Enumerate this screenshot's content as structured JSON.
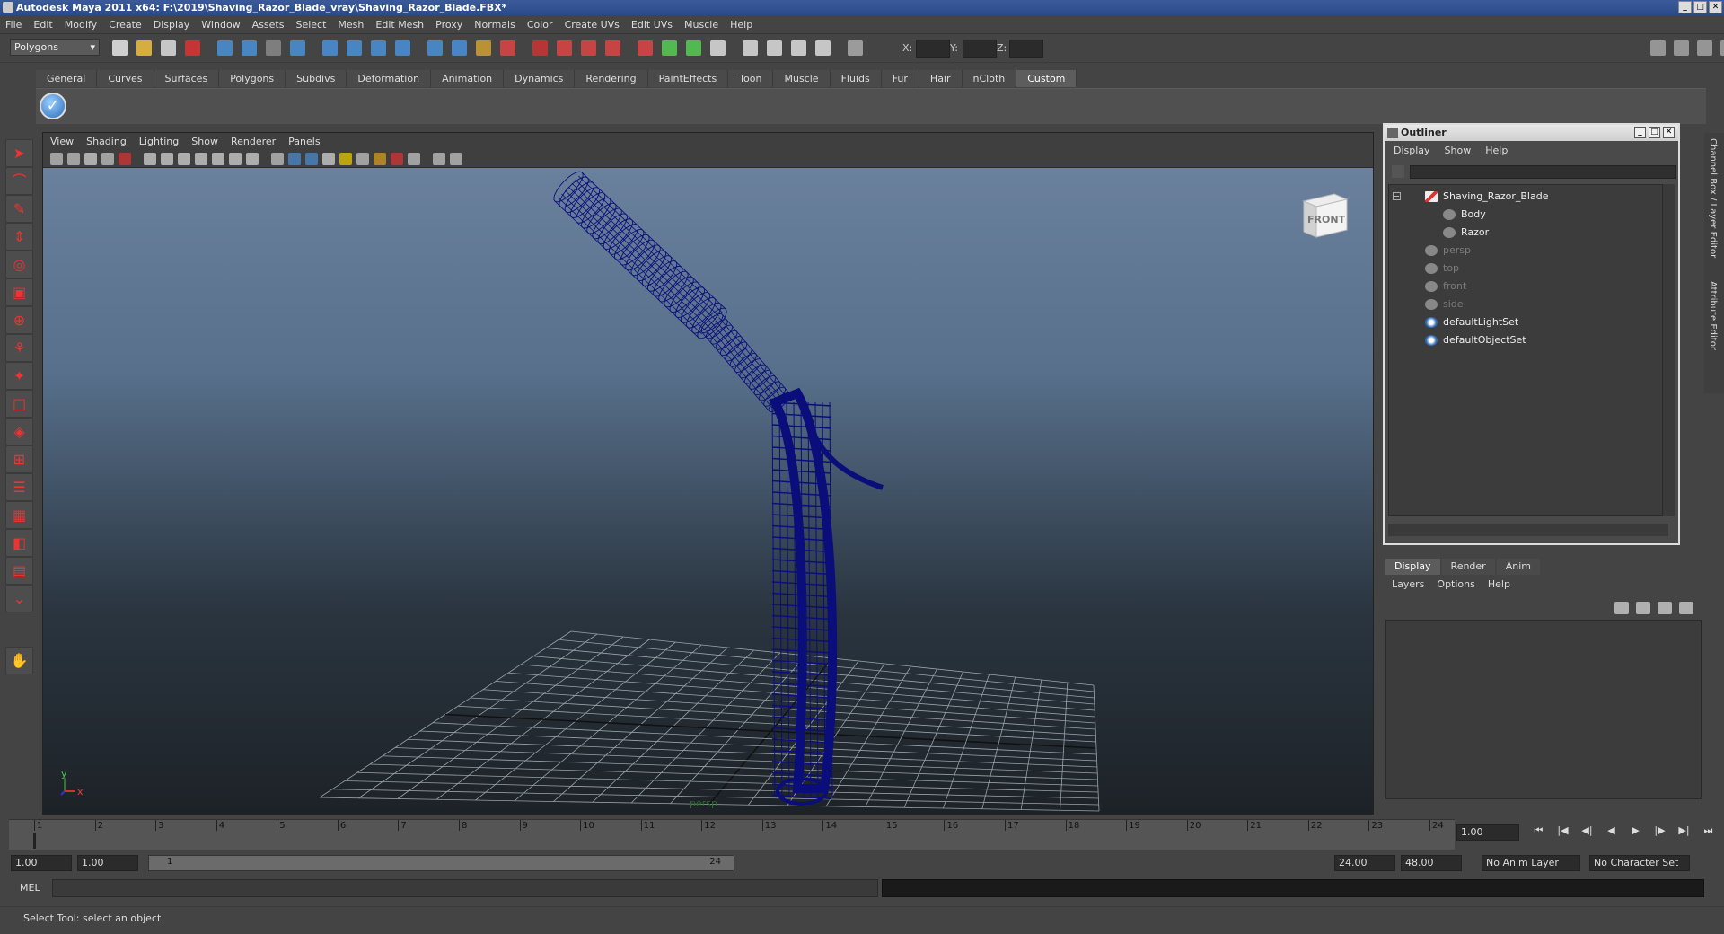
{
  "window": {
    "title": "Autodesk Maya 2011 x64: F:\\2019\\Shaving_Razor_Blade_vray\\Shaving_Razor_Blade.FBX*"
  },
  "menubar": [
    "File",
    "Edit",
    "Modify",
    "Create",
    "Display",
    "Window",
    "Assets",
    "Select",
    "Mesh",
    "Edit Mesh",
    "Proxy",
    "Normals",
    "Color",
    "Create UVs",
    "Edit UVs",
    "Muscle",
    "Help"
  ],
  "toolbar": {
    "mode": "Polygons",
    "x_label": "X:",
    "y_label": "Y:",
    "z_label": "Z:"
  },
  "shelf": {
    "tabs": [
      "General",
      "Curves",
      "Surfaces",
      "Polygons",
      "Subdivs",
      "Deformation",
      "Animation",
      "Dynamics",
      "Rendering",
      "PaintEffects",
      "Toon",
      "Muscle",
      "Fluids",
      "Fur",
      "Hair",
      "nCloth",
      "Custom"
    ],
    "active": "Custom"
  },
  "viewport": {
    "menu": [
      "View",
      "Shading",
      "Lighting",
      "Show",
      "Renderer",
      "Panels"
    ],
    "viewcube_label": "FRONT",
    "axis_y": "y",
    "axis_x": "x",
    "camera_label": "persp",
    "wire_color": "#0b0e7a"
  },
  "outliner": {
    "title": "Outliner",
    "menu": [
      "Display",
      "Show",
      "Help"
    ],
    "items": [
      {
        "label": "Shaving_Razor_Blade",
        "dim": false,
        "type": "root"
      },
      {
        "label": "Body",
        "dim": false,
        "type": "mesh"
      },
      {
        "label": "Razor",
        "dim": false,
        "type": "mesh"
      },
      {
        "label": "persp",
        "dim": true,
        "type": "camera"
      },
      {
        "label": "top",
        "dim": true,
        "type": "camera"
      },
      {
        "label": "front",
        "dim": true,
        "type": "camera"
      },
      {
        "label": "side",
        "dim": true,
        "type": "camera"
      },
      {
        "label": "defaultLightSet",
        "dim": false,
        "type": "set"
      },
      {
        "label": "defaultObjectSet",
        "dim": false,
        "type": "set"
      }
    ]
  },
  "side_tabs": {
    "channel_box": "Channel Box / Layer Editor",
    "attribute_editor": "Attribute Editor"
  },
  "layers": {
    "tabs": [
      "Display",
      "Render",
      "Anim"
    ],
    "active": "Display",
    "menu": [
      "Layers",
      "Options",
      "Help"
    ]
  },
  "timeline": {
    "start": 1,
    "end": 24,
    "current": "1.00",
    "numbers": [
      1,
      2,
      3,
      4,
      5,
      6,
      7,
      8,
      9,
      10,
      11,
      12,
      13,
      14,
      15,
      16,
      17,
      18,
      19,
      20,
      21,
      22,
      23,
      24
    ]
  },
  "range": {
    "start_time": "1.00",
    "playback_start": "1.00",
    "slider_start": "1",
    "slider_end": "24",
    "playback_end": "24.00",
    "end_time": "48.00",
    "anim_layer": "No Anim Layer",
    "character_set": "No Character Set"
  },
  "cmd": {
    "label": "MEL"
  },
  "status": {
    "text": "Select Tool: select an object"
  }
}
